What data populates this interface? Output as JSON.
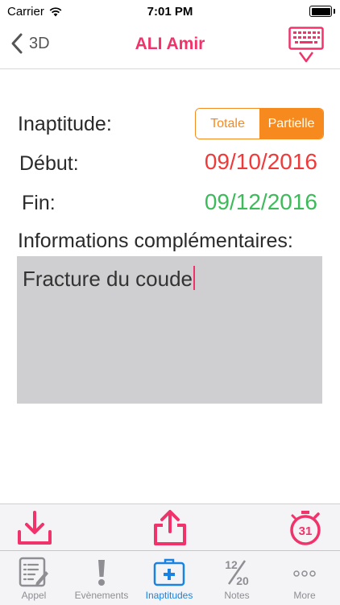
{
  "status_bar": {
    "carrier": "Carrier",
    "time": "7:01 PM",
    "battery_level": 1.0
  },
  "nav": {
    "back_label": "3D",
    "title": "ALI Amir"
  },
  "form": {
    "inaptitude_label": "Inaptitude:",
    "segments": [
      {
        "label": "Totale",
        "selected": false
      },
      {
        "label": "Partielle",
        "selected": true
      }
    ],
    "start_label": "Début:",
    "start_date": "09/10/2016",
    "end_label": "Fin:",
    "end_date": "09/12/2016",
    "info_label": "Informations complémentaires:",
    "info_value": "Fracture du coude"
  },
  "tabs": [
    {
      "label": "Appel",
      "icon": "notepad-icon",
      "active": false
    },
    {
      "label": "Evènements",
      "icon": "exclamation-icon",
      "active": false
    },
    {
      "label": "Inaptitudes",
      "icon": "medical-kit-icon",
      "active": true
    },
    {
      "label": "Notes",
      "icon": "grade-fraction-icon",
      "active": false
    },
    {
      "label": "More",
      "icon": "more-dots-icon",
      "active": false
    }
  ],
  "tab_notes_fraction": {
    "numerator": "12",
    "denominator": "20"
  },
  "calendar_badge": "31",
  "colors": {
    "accent_pink": "#f0336a",
    "segment_orange": "#f78a1e",
    "start_date_red": "#ef3a3a",
    "end_date_green": "#3dbb5a",
    "tab_active_blue": "#1a82e0"
  }
}
